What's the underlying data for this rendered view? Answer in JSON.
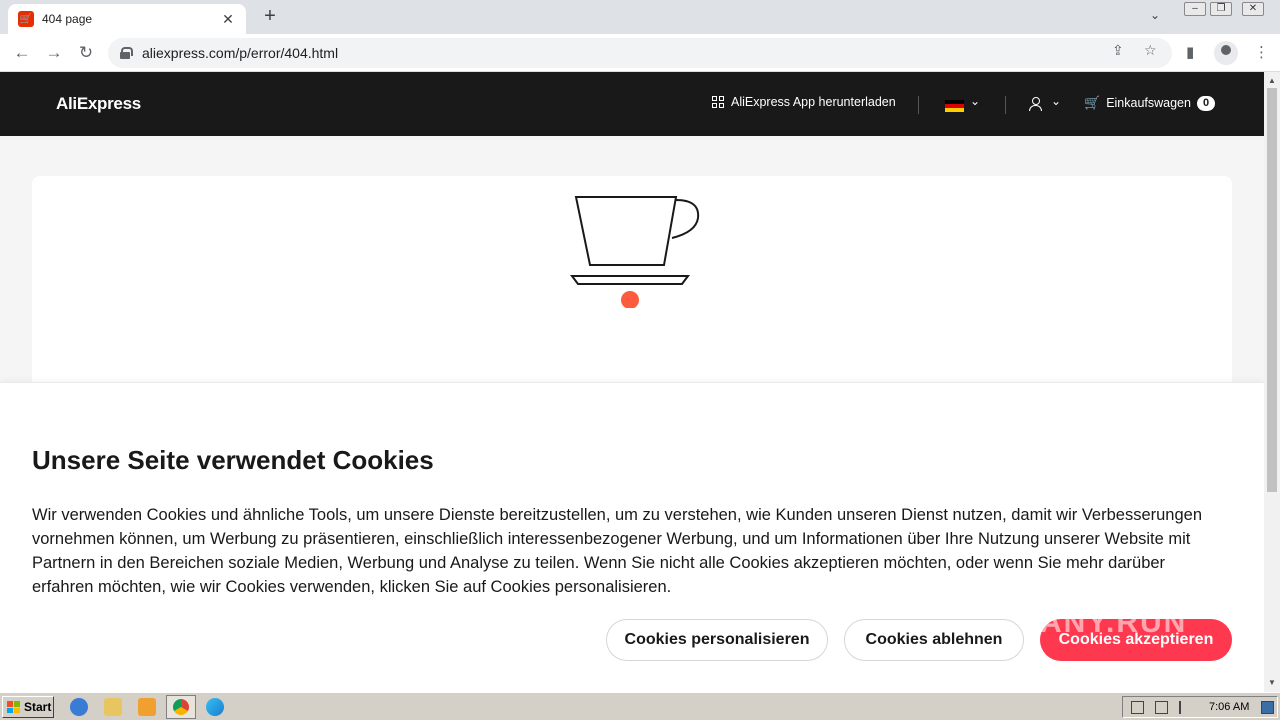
{
  "browser": {
    "tab_title": "404 page",
    "url": "aliexpress.com/p/error/404.html"
  },
  "header": {
    "logo": "AliExpress",
    "app_download": "AliExpress App herunterladen",
    "cart_label": "Einkaufswagen",
    "cart_count": "0"
  },
  "cookie_banner": {
    "title": "Unsere Seite verwendet Cookies",
    "text": "Wir verwenden Cookies und ähnliche Tools, um unsere Dienste bereitzustellen, um zu verstehen, wie Kunden unseren Dienst nutzen, damit wir Verbesserungen vornehmen können, um Werbung zu präsentieren, einschließlich interessenbezogener Werbung, und um Informationen über Ihre Nutzung unserer Website mit Partnern in den Bereichen soziale Medien, Werbung und Analyse zu teilen. Wenn Sie nicht alle Cookies akzeptieren möchten, oder wenn Sie mehr darüber erfahren möchten, wie wir Cookies verwenden, klicken Sie auf Cookies personalisieren.",
    "btn_personalize": "Cookies personalisieren",
    "btn_decline": "Cookies ablehnen",
    "btn_accept": "Cookies akzeptieren"
  },
  "taskbar": {
    "start_label": "Start",
    "clock": "7:06 AM"
  },
  "watermark": "ANY.RUN",
  "colors": {
    "header_bg": "#191919",
    "accept_button": "#fd384f",
    "page_bg": "#f5f5f5"
  }
}
